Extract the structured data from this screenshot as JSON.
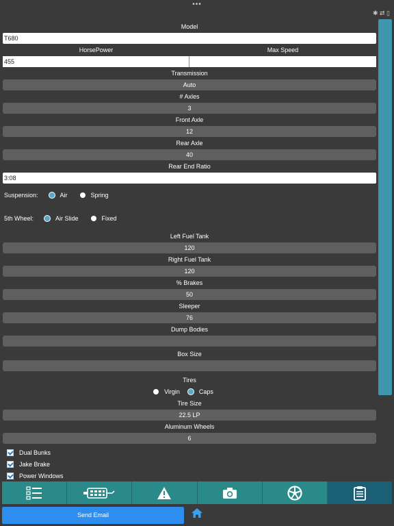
{
  "status": {
    "dots": "•••",
    "icons": "✱ ⇄ ▯"
  },
  "form": {
    "model": {
      "label": "Model",
      "value": "T680"
    },
    "horsepower": {
      "label": "HorsePower",
      "value": "455"
    },
    "max_speed": {
      "label": "Max Speed",
      "value": ""
    },
    "transmission": {
      "label": "Transmission",
      "value": "Auto"
    },
    "axles": {
      "label": "# Axles",
      "value": "3"
    },
    "front_axle": {
      "label": "Front Axle",
      "value": "12"
    },
    "rear_axle": {
      "label": "Rear Axle",
      "value": "40"
    },
    "rear_end_ratio": {
      "label": "Rear End Ratio",
      "value": "3:08"
    },
    "suspension": {
      "label": "Suspension:",
      "option_a": "Air",
      "option_b": "Spring",
      "selected": "Air"
    },
    "fifth_wheel": {
      "label": "5th Wheel:",
      "option_a": "Air Slide",
      "option_b": "Fixed",
      "selected": "Air Slide"
    },
    "left_fuel_tank": {
      "label": "Left Fuel Tank",
      "value": "120"
    },
    "right_fuel_tank": {
      "label": "Right Fuel Tank",
      "value": "120"
    },
    "brakes": {
      "label": "% Brakes",
      "value": "50"
    },
    "sleeper": {
      "label": "Sleeper",
      "value": "76"
    },
    "dump_bodies": {
      "label": "Dump Bodies",
      "value": ""
    },
    "box_size": {
      "label": "Box Size",
      "value": ""
    },
    "tires": {
      "label": "Tires",
      "option_a": "Virgin",
      "option_b": "Caps",
      "selected": "Caps"
    },
    "tire_size": {
      "label": "Tire Size",
      "value": "22.5 LP"
    },
    "aluminum_wheels": {
      "label": "Aluminum Wheels",
      "value": "6"
    }
  },
  "checkboxes": [
    {
      "label": "Dual Bunks",
      "checked": true
    },
    {
      "label": "Jake Brake",
      "checked": true
    },
    {
      "label": "Power Windows",
      "checked": true
    }
  ],
  "tabbar": {
    "tabs": [
      {
        "icon": "checklist-icon"
      },
      {
        "icon": "truck-engine-icon"
      },
      {
        "icon": "warning-icon"
      },
      {
        "icon": "camera-icon"
      },
      {
        "icon": "wheel-icon"
      },
      {
        "icon": "clipboard-icon",
        "active": true
      }
    ]
  },
  "actions": {
    "send_email": "Send Email"
  },
  "colors": {
    "background": "#3a3a3a",
    "tab": "#2a8a8a",
    "tab_active": "#1a5f73",
    "button": "#2d8ef0",
    "scrollbar": "#3f96ad"
  }
}
